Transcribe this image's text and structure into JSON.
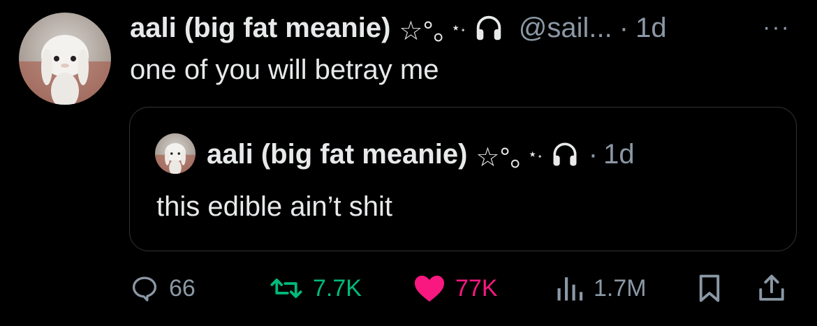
{
  "tweet": {
    "author_name": "aali (big fat meanie)",
    "author_deco": "☆°｡",
    "author_deco_small": "⋆˖",
    "handle": "@sail...",
    "separator": "·",
    "time": "1d",
    "more": "···",
    "text": "one of you will betray me",
    "icons": {
      "avatar": "avatar-plush-rabbit",
      "badge": "headphones-icon"
    }
  },
  "quote": {
    "author_name": "aali (big fat meanie)",
    "author_deco": "☆°｡",
    "author_deco_small": "⋆˖",
    "separator": "·",
    "time": "1d",
    "text": "this edible ain’t shit"
  },
  "actions": {
    "replies": "66",
    "retweets": "7.7K",
    "likes": "77K",
    "views": "1.7M"
  },
  "colors": {
    "background": "#000000",
    "text": "#e7e9ea",
    "secondary": "#8b98a5",
    "retweet_green": "#00ba7c",
    "like_pink": "#f91880",
    "border": "#2f3336"
  }
}
